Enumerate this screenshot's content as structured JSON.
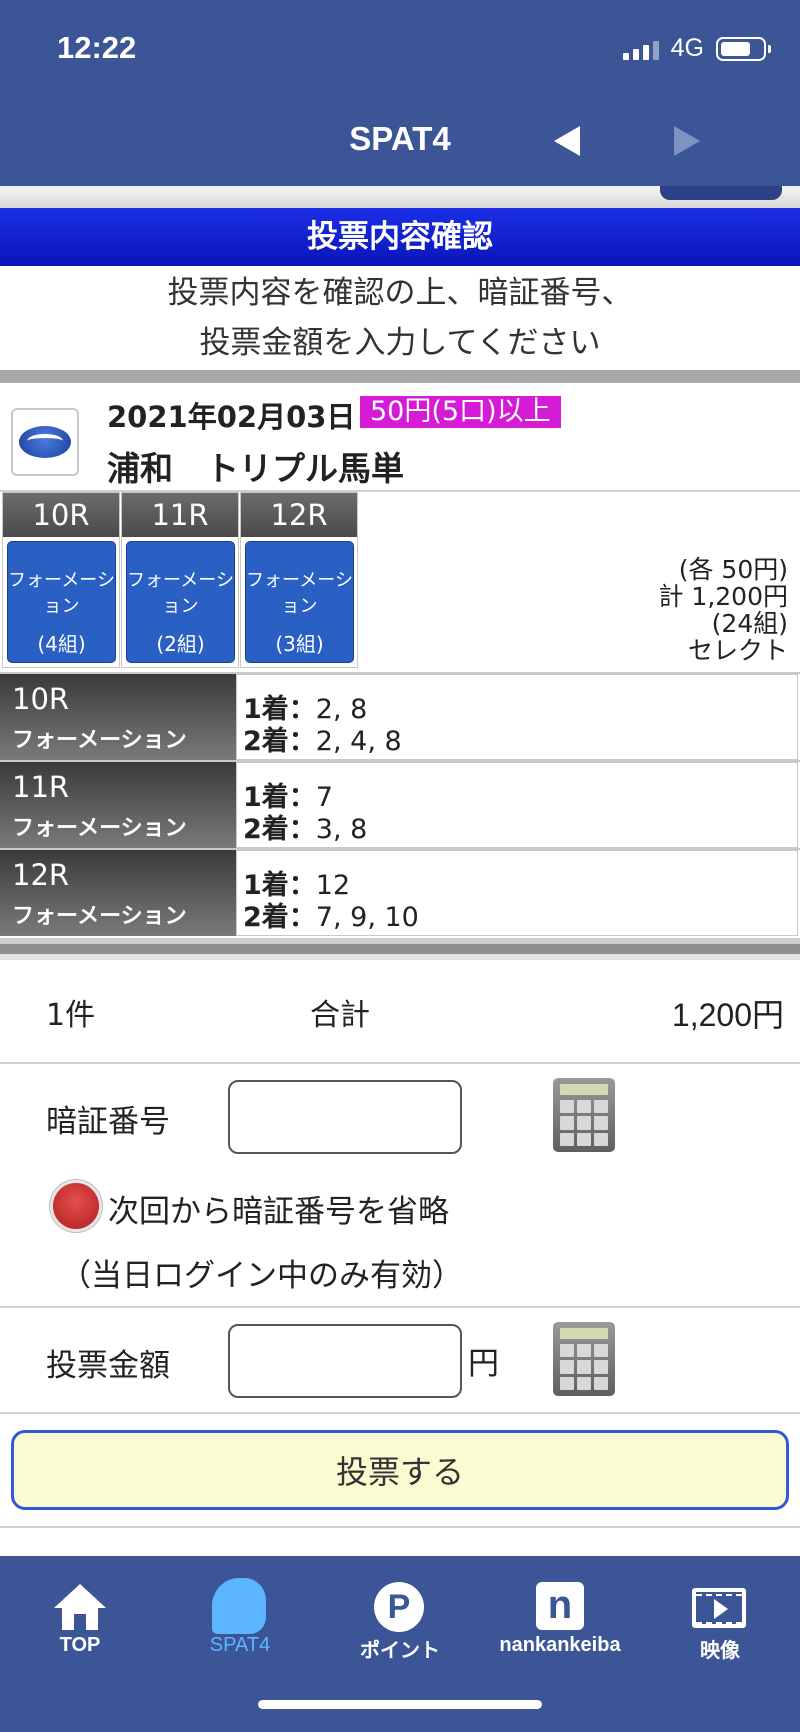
{
  "status_bar": {
    "time": "12:22",
    "network": "4G"
  },
  "nav": {
    "title": "SPAT4",
    "prev_icon": "arrow-left-icon",
    "next_icon": "arrow-right-icon"
  },
  "header": {
    "title": "投票内容確認"
  },
  "instructions": [
    "投票内容を確認の上、暗証番号、",
    "投票金額を入力してください"
  ],
  "race": {
    "logo_icon": "urawa-logo",
    "date": "2021年02月03日",
    "min_bet": "50円(5口)以上",
    "name": "浦和　トリプル馬単"
  },
  "tabs": [
    {
      "race": "10R",
      "type": "フォーメーション",
      "combos": "(4組)"
    },
    {
      "race": "11R",
      "type": "フォーメーション",
      "combos": "(2組)"
    },
    {
      "race": "12R",
      "type": "フォーメーション",
      "combos": "(3組)"
    }
  ],
  "summary": {
    "each": "(各 50円)",
    "total": "計 1,200円",
    "combos": "(24組)",
    "mode": "セレクト"
  },
  "details": [
    {
      "race": "10R",
      "type": "フォーメーション",
      "first_label": "1着：",
      "first": "2, 8",
      "second_label": "2着：",
      "second": "2, 4, 8"
    },
    {
      "race": "11R",
      "type": "フォーメーション",
      "first_label": "1着：",
      "first": "7",
      "second_label": "2着：",
      "second": "3, 8"
    },
    {
      "race": "12R",
      "type": "フォーメーション",
      "first_label": "1着：",
      "first": "12",
      "second_label": "2着：",
      "second": "7, 9, 10"
    }
  ],
  "total": {
    "count": "1件",
    "label": "合計",
    "amount": "1,200円"
  },
  "pin": {
    "label": "暗証番号",
    "value": "",
    "placeholder": ""
  },
  "remember": {
    "label": "次回から暗証番号を省略",
    "note": "（当日ログイン中のみ有効）"
  },
  "amount": {
    "label": "投票金額",
    "value": "",
    "placeholder": "",
    "unit": "円"
  },
  "submit": {
    "label": "投票する"
  },
  "tabbar": [
    {
      "label": "TOP",
      "icon": "home-icon",
      "active": false
    },
    {
      "label": "SPAT4",
      "icon": "horse-icon",
      "active": true
    },
    {
      "label": "ポイント",
      "icon": "point-icon",
      "active": false
    },
    {
      "label": "nankankeiba",
      "icon": "n-icon",
      "active": false
    },
    {
      "label": "映像",
      "icon": "video-icon",
      "active": false
    }
  ],
  "colors": {
    "navy": "#3b5596",
    "header_blue": "#0a15b9",
    "badge_magenta": "#d61bd6",
    "tab_blue": "#2a5fc4",
    "active_tab": "#5cb6ff",
    "button_bg": "#fbfbd2"
  }
}
